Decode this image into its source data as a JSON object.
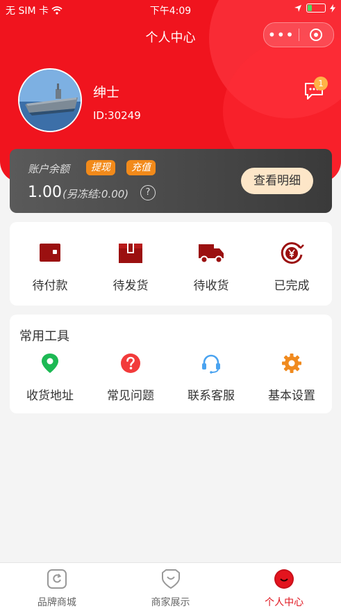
{
  "status_bar": {
    "carrier": "无 SIM 卡",
    "time": "下午4:09"
  },
  "title_bar": {
    "title": "个人中心"
  },
  "profile": {
    "username": "绅士",
    "user_id": "ID:30249",
    "message_badge": "1"
  },
  "balance": {
    "label": "账户余额",
    "withdraw_label": "提现",
    "recharge_label": "充值",
    "amount": "1.00",
    "frozen": "(另冻结:0.00)",
    "help_symbol": "?",
    "detail_button": "查看明细"
  },
  "orders": [
    {
      "label": "待付款",
      "icon": "wallet-icon"
    },
    {
      "label": "待发货",
      "icon": "box-icon"
    },
    {
      "label": "待收货",
      "icon": "truck-icon"
    },
    {
      "label": "已完成",
      "icon": "yen-coin-icon"
    }
  ],
  "tools": {
    "title": "常用工具",
    "items": [
      {
        "label": "收货地址",
        "icon": "location-icon",
        "color": "#1db954"
      },
      {
        "label": "常见问题",
        "icon": "question-icon",
        "color": "#f23b3b"
      },
      {
        "label": "联系客服",
        "icon": "headset-icon",
        "color": "#4aa3f0"
      },
      {
        "label": "基本设置",
        "icon": "gear-icon",
        "color": "#f08a1e"
      }
    ]
  },
  "tabbar": [
    {
      "label": "品牌商城",
      "active": false
    },
    {
      "label": "商家展示",
      "active": false
    },
    {
      "label": "个人中心",
      "active": true
    }
  ],
  "colors": {
    "brand_red": "#f0141e",
    "dark_red": "#9b1010",
    "accent_orange": "#f28a1a"
  }
}
